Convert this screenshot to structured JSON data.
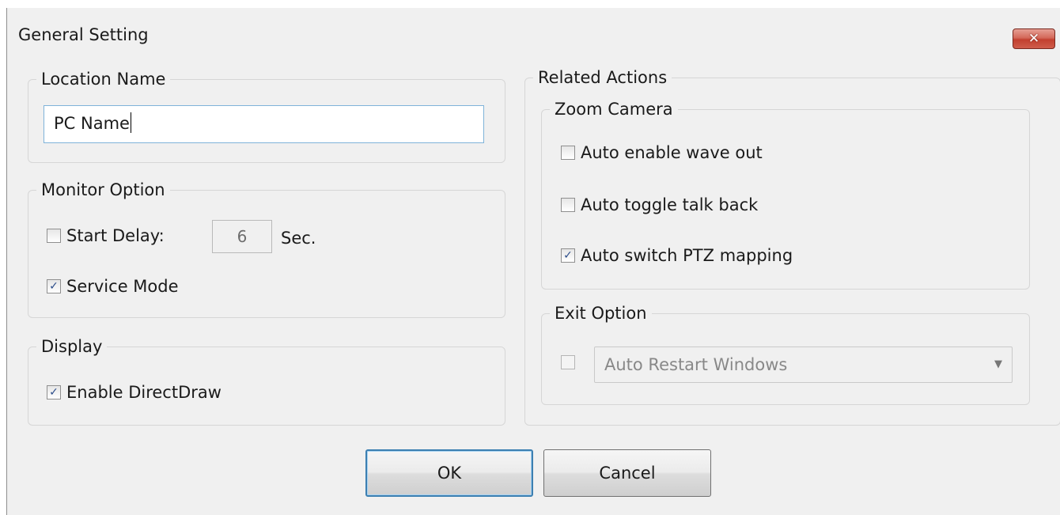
{
  "window": {
    "title": "General Setting",
    "close_label": "✕"
  },
  "location": {
    "legend": "Location Name",
    "name_value": "PC Name"
  },
  "monitor": {
    "legend": "Monitor Option",
    "start_delay_label": "Start Delay:",
    "start_delay_checked": false,
    "delay_value": "6",
    "delay_unit": "Sec.",
    "service_mode_label": "Service Mode",
    "service_mode_checked": true
  },
  "display": {
    "legend": "Display",
    "directdraw_label": "Enable DirectDraw",
    "directdraw_checked": true
  },
  "related": {
    "legend": "Related Actions",
    "zoom": {
      "legend": "Zoom Camera",
      "wave_out_label": "Auto enable wave out",
      "wave_out_checked": false,
      "talk_back_label": "Auto toggle talk back",
      "talk_back_checked": false,
      "ptz_label": "Auto switch PTZ mapping",
      "ptz_checked": true
    },
    "exit": {
      "legend": "Exit Option",
      "exit_checked": false,
      "select_value": "Auto Restart Windows"
    }
  },
  "buttons": {
    "ok_label": "OK",
    "cancel_label": "Cancel"
  }
}
